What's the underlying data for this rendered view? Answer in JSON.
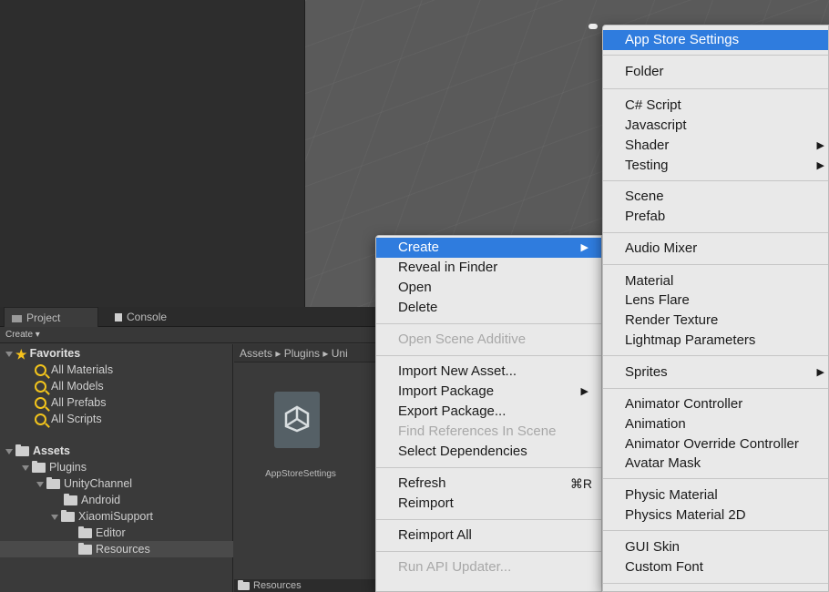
{
  "tabs": {
    "project": "Project",
    "console": "Console"
  },
  "toolbar": {
    "create": "Create ▾"
  },
  "favorites": {
    "title": "Favorites",
    "items": [
      "All Materials",
      "All Models",
      "All Prefabs",
      "All Scripts"
    ]
  },
  "assets_tree": {
    "assets": "Assets",
    "plugins": "Plugins",
    "unity_channel": "UnityChannel",
    "android": "Android",
    "xiaomi_support": "XiaomiSupport",
    "editor": "Editor",
    "resources": "Resources"
  },
  "breadcrumb": "Assets ▸ Plugins ▸ Uni",
  "asset_item": {
    "label": "AppStoreSettings"
  },
  "bottom_bar": {
    "path": "Resources"
  },
  "context_menu": {
    "create": "Create",
    "reveal_in_finder": "Reveal in Finder",
    "open": "Open",
    "delete": "Delete",
    "open_scene_additive": "Open Scene Additive",
    "import_new_asset": "Import New Asset...",
    "import_package": "Import Package",
    "export_package": "Export Package...",
    "find_references": "Find References In Scene",
    "select_dependencies": "Select Dependencies",
    "refresh": "Refresh",
    "refresh_shortcut": "⌘R",
    "reimport": "Reimport",
    "reimport_all": "Reimport All",
    "run_api_updater": "Run API Updater..."
  },
  "create_menu": {
    "app_store_settings": "App Store Settings",
    "folder": "Folder",
    "csharp_script": "C# Script",
    "javascript": "Javascript",
    "shader": "Shader",
    "testing": "Testing",
    "scene": "Scene",
    "prefab": "Prefab",
    "audio_mixer": "Audio Mixer",
    "material": "Material",
    "lens_flare": "Lens Flare",
    "render_texture": "Render Texture",
    "lightmap_parameters": "Lightmap Parameters",
    "sprites": "Sprites",
    "animator_controller": "Animator Controller",
    "animation": "Animation",
    "animator_override_controller": "Animator Override Controller",
    "avatar_mask": "Avatar Mask",
    "physic_material": "Physic Material",
    "physics_material_2d": "Physics Material 2D",
    "gui_skin": "GUI Skin",
    "custom_font": "Custom Font"
  },
  "colors": {
    "highlight": "#2f7cde",
    "menu_bg": "#e9e9e9",
    "panel_bg": "#3a3a3a",
    "favorite_star": "#f6c21c"
  }
}
